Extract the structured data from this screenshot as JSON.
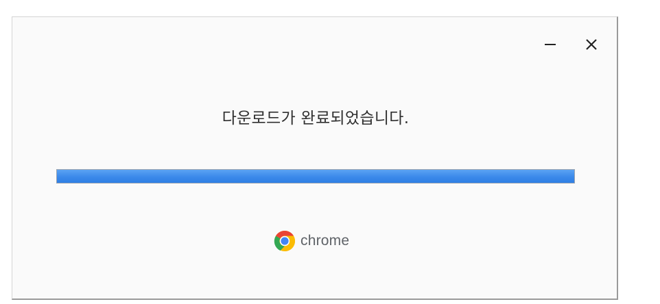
{
  "window": {
    "message": "다운로드가 완료되었습니다.",
    "progress": 1.0,
    "brand_name": "chrome"
  },
  "controls": {
    "minimize_icon": "minimize-icon",
    "close_icon": "close-icon"
  },
  "colors": {
    "progress_fill": "#3b89ea",
    "background": "#fafafa",
    "brand_text": "#5f6368"
  }
}
